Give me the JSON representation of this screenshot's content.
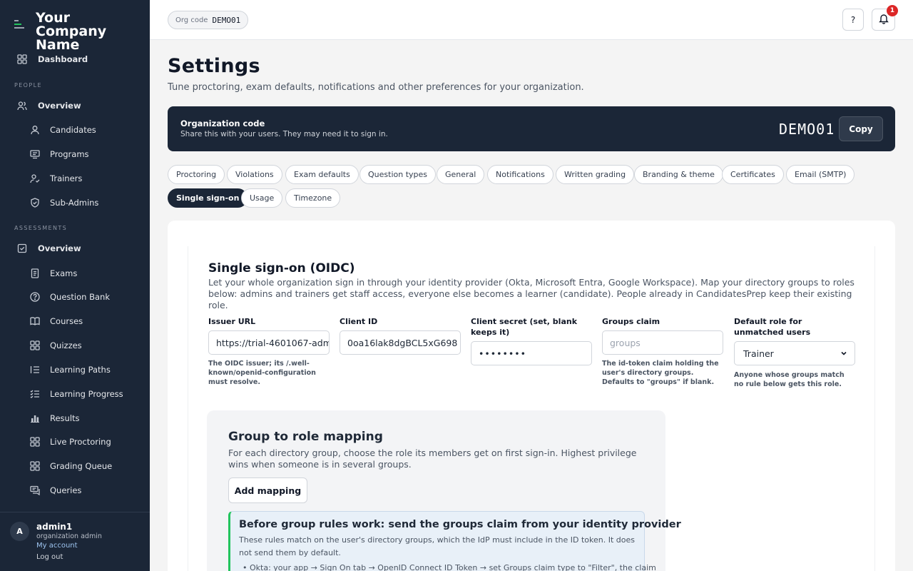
{
  "sidebar": {
    "brand": "Your Company Name",
    "dashboard": "Dashboard",
    "people_label": "PEOPLE",
    "people_overview": "Overview",
    "people_items": [
      "Candidates",
      "Programs",
      "Trainers",
      "Sub-Admins"
    ],
    "assessments_label": "ASSESSMENTS",
    "assessments_overview": "Overview",
    "assessments_items": [
      "Exams",
      "Question Bank",
      "Courses",
      "Quizzes",
      "Learning Paths",
      "Learning Progress",
      "Results",
      "Live Proctoring",
      "Grading Queue",
      "Queries"
    ],
    "user": {
      "initial": "A",
      "name": "admin1",
      "role": "organization admin",
      "my_account": "My account",
      "log_out": "Log out"
    }
  },
  "topbar": {
    "org_code_label": "Org code",
    "org_code": "DEMO01",
    "help": "?",
    "notifications_count": "1"
  },
  "page": {
    "title": "Settings",
    "subtitle": "Tune proctoring, exam defaults, notifications and other preferences for your organization."
  },
  "org_banner": {
    "title": "Organization code",
    "subtitle": "Share this with your users. They may need it to sign in.",
    "code": "DEMO01",
    "copy_label": "Copy"
  },
  "tabs": [
    "Proctoring",
    "Violations",
    "Exam defaults",
    "Question types",
    "General",
    "Notifications",
    "Written grading",
    "Branding & theme",
    "Certificates",
    "Email (SMTP)",
    "Single sign-on",
    "Usage",
    "Timezone"
  ],
  "active_tab": "Single sign-on",
  "sso": {
    "title": "Single sign-on (OIDC)",
    "description": "Let your whole organization sign in through your identity provider (Okta, Microsoft Entra, Google Workspace). Map your directory groups to roles below: admins and trainers get staff access, everyone else becomes a learner (candidate). People already in CandidatesPrep keep their existing role.",
    "issuer_url": {
      "label": "Issuer URL",
      "value": "https://trial-4601067-adm",
      "help": "The OIDC issuer; its /.well-known/openid-configuration must resolve."
    },
    "client_id": {
      "label": "Client ID",
      "value": "0oa16lak8dgBCL5xG698"
    },
    "client_secret": {
      "label": "Client secret (set, blank keeps it)",
      "value": "••••••••"
    },
    "groups_claim": {
      "label": "Groups claim",
      "placeholder": "groups",
      "help": "The id-token claim holding the user's directory groups. Defaults to \"groups\" if blank."
    },
    "default_role": {
      "label": "Default role for unmatched users",
      "value": "Trainer",
      "help": "Anyone whose groups match no rule below gets this role."
    }
  },
  "mapping": {
    "title": "Group to role mapping",
    "description": "For each directory group, choose the role its members get on first sign-in. Highest privilege wins when someone is in several groups.",
    "add_label": "Add mapping",
    "info": {
      "title": "Before group rules work: send the groups claim from your identity provider",
      "text": "These rules match on the user's directory groups, which the IdP must include in the ID token. It does not send them by default.",
      "bullet": "Okta: your app → Sign On tab → OpenID Connect ID Token → set Groups claim type to \"Filter\", the claim"
    }
  },
  "colors": {
    "sidebar_bg": "#1b2637",
    "accent_dark": "#1b2637",
    "badge": "#dc2626",
    "link": "#9ec5f0",
    "info_border": "#22c55e"
  }
}
